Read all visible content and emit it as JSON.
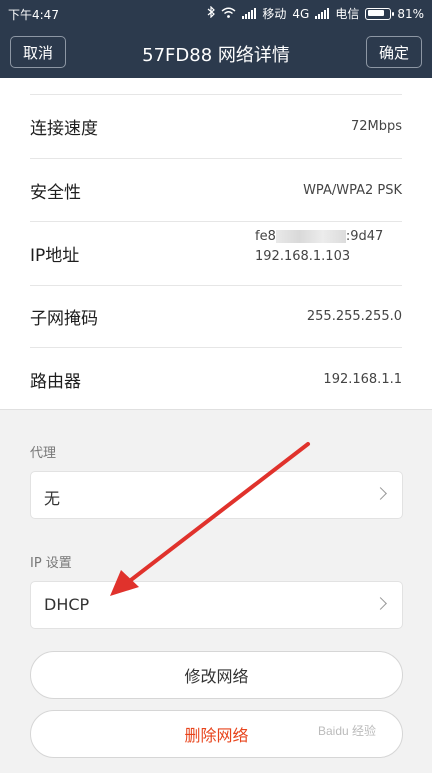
{
  "status_bar": {
    "time": "下午4:47",
    "carrier1": "移动",
    "network": "4G",
    "carrier2": "电信",
    "battery": "81%",
    "battery_level": 0.81,
    "icons": [
      "bluetooth-icon",
      "wifi-icon",
      "signal-icon",
      "battery-icon"
    ]
  },
  "header": {
    "cancel_label": "取消",
    "title": "57FD88  网络详情",
    "confirm_label": "确定",
    "background": "#2c3a4d"
  },
  "details": {
    "speed": {
      "label": "连接速度",
      "value": "72Mbps"
    },
    "security": {
      "label": "安全性",
      "value": "WPA/WPA2 PSK"
    },
    "ip": {
      "label": "IP地址",
      "value_line1_start": "fe8",
      "value_line1_end": ":9d47",
      "value_line2": "192.168.1.103"
    },
    "subnet": {
      "label": "子网掩码",
      "value": "255.255.255.0"
    },
    "router": {
      "label": "路由器",
      "value": "192.168.1.1"
    }
  },
  "proxy": {
    "label": "代理",
    "value": "无"
  },
  "ip_settings": {
    "label": "IP 设置",
    "value": "DHCP"
  },
  "actions": {
    "modify_label": "修改网络",
    "delete_label": "删除网络",
    "delete_color": "#e8441c"
  },
  "annotation": {
    "arrow_color": "#e0322c"
  },
  "watermark": "Baidu 经验"
}
